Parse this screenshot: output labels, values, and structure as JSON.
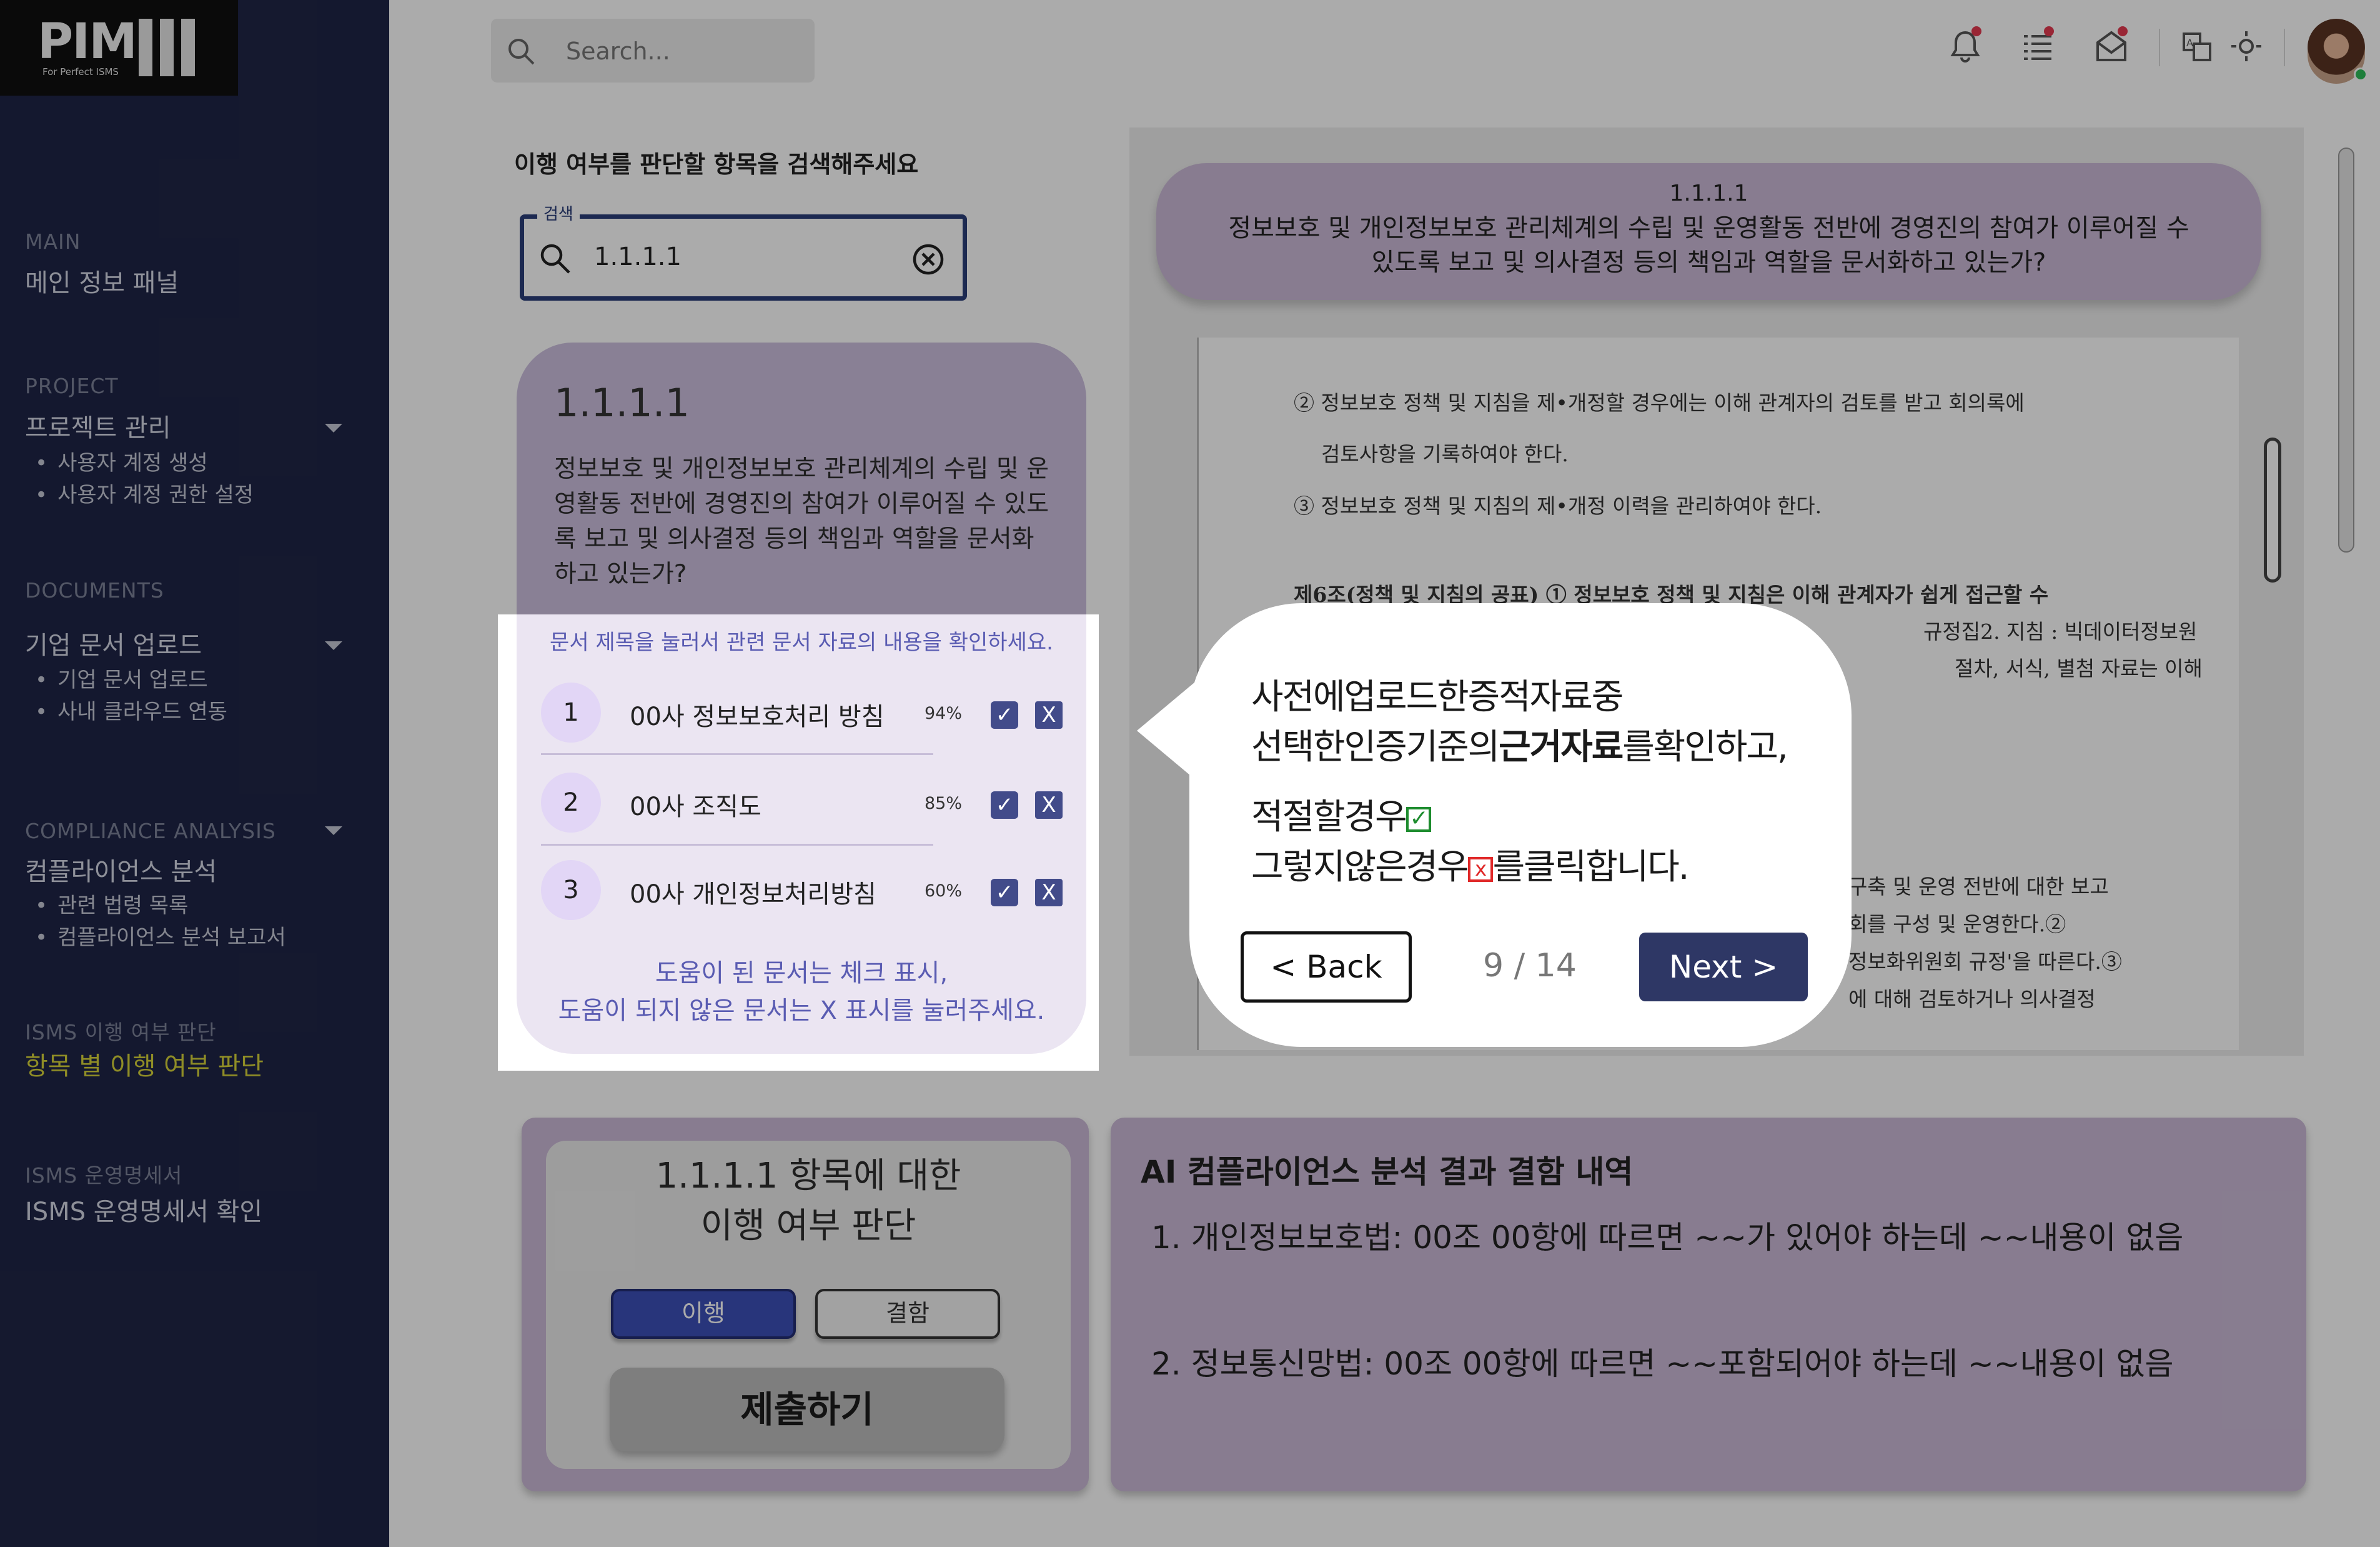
{
  "logo": {
    "text": "PIM",
    "tagline": "For Perfect ISMS"
  },
  "sidebar": {
    "main": {
      "label": "MAIN",
      "title": "메인 정보 패널"
    },
    "project": {
      "label": "PROJECT",
      "title": "프로젝트 관리",
      "items": [
        "사용자 계정 생성",
        "사용자 계정 권한 설정"
      ]
    },
    "documents": {
      "label": "DOCUMENTS",
      "title": "기업 문서 업로드",
      "items": [
        "기업 문서 업로드",
        "사내 클라우드 연동"
      ]
    },
    "compliance": {
      "label": "COMPLIANCE ANALYSIS",
      "title": "컴플라이언스 분석",
      "items": [
        "관련 법령 목록",
        "컴플라이언스 분석 보고서"
      ]
    },
    "isms_judge": {
      "label": "ISMS 이행 여부 판단",
      "title": "항목 별 이행 여부 판단"
    },
    "isms_ops": {
      "label": "ISMS 운영명세서",
      "title": "ISMS 운영명세서 확인"
    },
    "active_color": "#d6d23a"
  },
  "topbar": {
    "search_placeholder": "Search...",
    "icons": [
      "notification-bell-icon",
      "task-list-icon",
      "mail-icon",
      "translate-icon",
      "theme-sun-icon"
    ]
  },
  "main": {
    "heading": "이행 여부를 판단할 항목을 검색해주세요",
    "search_legend": "검색",
    "search_value": "1.1.1.1",
    "item": {
      "code": "1.1.1.1",
      "question": "정보보호 및 개인정보보호 관리체계의 수립 및 운영활동 전반에 경영진의 참여가 이루어질 수 있도록 보고 및 의사결정 등의 책임과 역할을 문서화하고 있는가?"
    },
    "doc_hint": "문서 제목을 눌러서 관련 문서 자료의 내용을 확인하세요.",
    "documents": [
      {
        "num": "1",
        "title": "00사 정보보호처리 방침",
        "pct": "94%"
      },
      {
        "num": "2",
        "title": "00사 조직도",
        "pct": "85%"
      },
      {
        "num": "3",
        "title": "00사 개인정보처리방침",
        "pct": "60%"
      }
    ],
    "doc_footer": [
      "도움이 된 문서는 체크 표시,",
      "도움이 되지 않은 문서는 X 표시를 눌러주세요."
    ]
  },
  "doc_viewer": {
    "code": "1.1.1.1",
    "question": "정보보호 및 개인정보보호 관리체계의 수립 및 운영활동 전반에 경영진의 참여가 이루어질 수 있도록 보고 및 의사결정 등의 책임과 역할을 문서화하고 있는가?",
    "lines": [
      "② 정보보호 정책 및 지침을 제•개정할 경우에는 이해 관계자의 검토를 받고 회의록에",
      "검토사항을 기록하여야 한다.",
      "③ 정보보호 정책 및 지침의 제•개정 이력을 관리하여야 한다.",
      "제6조(정책 및 지침의 공표) ① 정보보호 정책 및 지침은 이해 관계자가 쉽게 접근할 수",
      "규정집2. 지침 : 빅데이터정보원",
      "절차, 서식, 별첨 자료는 이해",
      "구축 및 운영 전반에 대한 보고",
      "회를 구성 및 운영한다.②",
      "정보화위원회 규정'을 따른다.③",
      "에 대해 검토하거나 의사결정"
    ]
  },
  "judge": {
    "title_line1": "1.1.1.1 항목에 대한",
    "title_line2": "이행 여부 판단",
    "pass_label": "이행",
    "fail_label": "결함",
    "submit_label": "제출하기"
  },
  "ai_result": {
    "title": "AI 컴플라이언스 분석 결과 결함 내역",
    "items": [
      "1. 개인정보보호법: 00조 00항에 따르면 ~~가 있어야 하는데 ~~내용이 없음",
      "2. 정보통신망법: 00조 00항에 따르면 ~~포함되어야 하는데 ~~내용이 없음"
    ]
  },
  "tour": {
    "line1": "사전에업로드한증적자료중",
    "line2_pre": "선택한인증기준의",
    "line2_bold": "근거자료",
    "line2_post": "를확인하고,",
    "line3": "적절할경우",
    "line4_pre": "그렇지않은경우",
    "line4_post": "를클릭합니다.",
    "back_label": "< Back",
    "step": "9 / 14",
    "next_label": "Next >"
  }
}
